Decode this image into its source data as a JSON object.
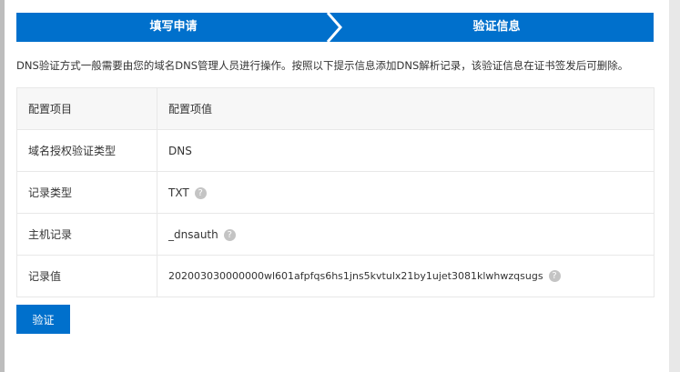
{
  "steps": [
    "填写申请",
    "验证信息"
  ],
  "description": "DNS验证方式一般需要由您的域名DNS管理人员进行操作。按照以下提示信息添加DNS解析记录，该验证信息在证书签发后可删除。",
  "table": {
    "headers": [
      "配置项目",
      "配置项值"
    ],
    "rows": [
      {
        "key": "域名授权验证类型",
        "value": "DNS",
        "help": false
      },
      {
        "key": "记录类型",
        "value": "TXT",
        "help": true
      },
      {
        "key": "主机记录",
        "value": "_dnsauth",
        "help": true
      },
      {
        "key": "记录值",
        "value": "202003030000000wl601afpfqs6hs1jns5kvtulx21by1ujet3081klwhwzqsugs",
        "help": true
      }
    ]
  },
  "help_glyph": "?",
  "verify_button": "验证"
}
